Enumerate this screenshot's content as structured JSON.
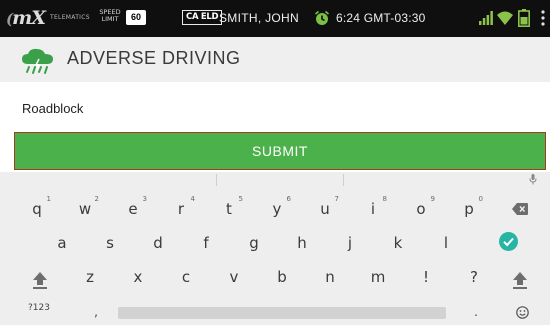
{
  "status_bar": {
    "brand": "mX",
    "brand_sub": "TELEMATICS",
    "speed_label": "SPEED LIMIT",
    "speed_limit": "60",
    "eld_badge": "CA ELD",
    "driver_name": "SMITH, JOHN",
    "time": "6:24 GMT-03:30"
  },
  "app_bar": {
    "title": "ADVERSE DRIVING"
  },
  "form": {
    "input_value": "Roadblock",
    "submit_label": "SUBMIT"
  },
  "keyboard": {
    "row1": [
      {
        "char": "q",
        "hint": "1"
      },
      {
        "char": "w",
        "hint": "2"
      },
      {
        "char": "e",
        "hint": "3"
      },
      {
        "char": "r",
        "hint": "4"
      },
      {
        "char": "t",
        "hint": "5"
      },
      {
        "char": "y",
        "hint": "6"
      },
      {
        "char": "u",
        "hint": "7"
      },
      {
        "char": "i",
        "hint": "8"
      },
      {
        "char": "o",
        "hint": "9"
      },
      {
        "char": "p",
        "hint": "0"
      }
    ],
    "row2": [
      "a",
      "s",
      "d",
      "f",
      "g",
      "h",
      "j",
      "k",
      "l"
    ],
    "row3": [
      "z",
      "x",
      "c",
      "v",
      "b",
      "n",
      "m",
      "!",
      "?"
    ],
    "num_key": "?123",
    "comma_key": ",",
    "period_key": "."
  },
  "colors": {
    "accent_green": "#4bb14a",
    "done_teal": "#26b5a3",
    "status_bar_bg": "#0f0f0f",
    "alarm_green": "#7bc043",
    "signal_green": "#8bc34a"
  }
}
